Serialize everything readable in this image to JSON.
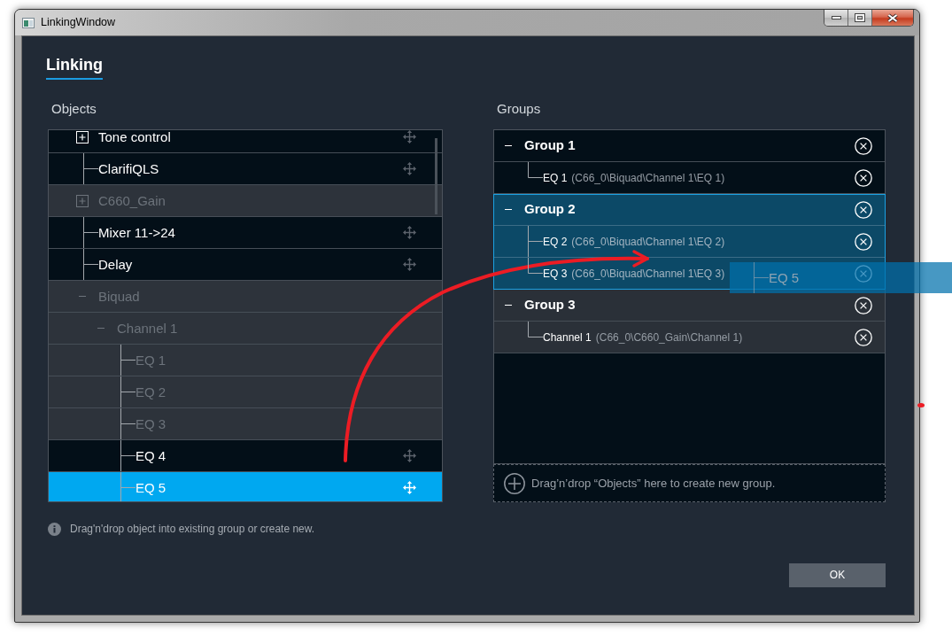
{
  "window": {
    "title": "LinkingWindow"
  },
  "heading": "Linking",
  "objects": {
    "title": "Objects",
    "tree": [
      {
        "label": "Tone control",
        "kind": "branch",
        "expanded": false,
        "disabled": false,
        "selected": false
      },
      {
        "label": "ClarifiQLS",
        "kind": "leaf",
        "disabled": false,
        "selected": false
      },
      {
        "label": "C660_Gain",
        "kind": "branch",
        "expanded": false,
        "disabled": true,
        "selected": false
      },
      {
        "label": "Mixer 11->24",
        "kind": "leaf",
        "disabled": false,
        "selected": false
      },
      {
        "label": "Delay",
        "kind": "leaf",
        "disabled": false,
        "selected": false
      },
      {
        "label": "Biquad",
        "kind": "branch",
        "expanded": true,
        "disabled": true,
        "selected": false,
        "children": [
          {
            "label": "Channel 1",
            "kind": "branch",
            "expanded": true,
            "disabled": true,
            "selected": false,
            "children": [
              {
                "label": "EQ 1",
                "kind": "leaf",
                "disabled": true,
                "selected": false
              },
              {
                "label": "EQ 2",
                "kind": "leaf",
                "disabled": true,
                "selected": false
              },
              {
                "label": "EQ 3",
                "kind": "leaf",
                "disabled": true,
                "selected": false
              },
              {
                "label": "EQ 4",
                "kind": "leaf",
                "disabled": false,
                "selected": false
              },
              {
                "label": "EQ 5",
                "kind": "leaf",
                "disabled": false,
                "selected": true
              }
            ]
          }
        ]
      }
    ]
  },
  "groups": {
    "title": "Groups",
    "items": [
      {
        "name": "Group 1",
        "expanded": true,
        "drop_target": false,
        "dimmed": false,
        "children": [
          {
            "name": "EQ 1",
            "path": "(C66_0\\Biquad\\Channel 1\\EQ 1)"
          }
        ]
      },
      {
        "name": "Group 2",
        "expanded": true,
        "drop_target": true,
        "dimmed": false,
        "children": [
          {
            "name": "EQ 2",
            "path": "(C66_0\\Biquad\\Channel 1\\EQ 2)"
          },
          {
            "name": "EQ 3",
            "path": "(C66_0\\Biquad\\Channel 1\\EQ 3)"
          }
        ]
      },
      {
        "name": "Group 3",
        "expanded": true,
        "drop_target": false,
        "dimmed": true,
        "children": [
          {
            "name": "Channel 1",
            "path": "(C66_0\\C660_Gain\\Channel 1)"
          }
        ]
      }
    ],
    "drop_zone": "Drag’n’drop “Objects” here to create new group."
  },
  "hint": "Drag'n'drop object into existing group or create new.",
  "drag_preview": {
    "label": "EQ 5"
  },
  "ok_button": "OK"
}
